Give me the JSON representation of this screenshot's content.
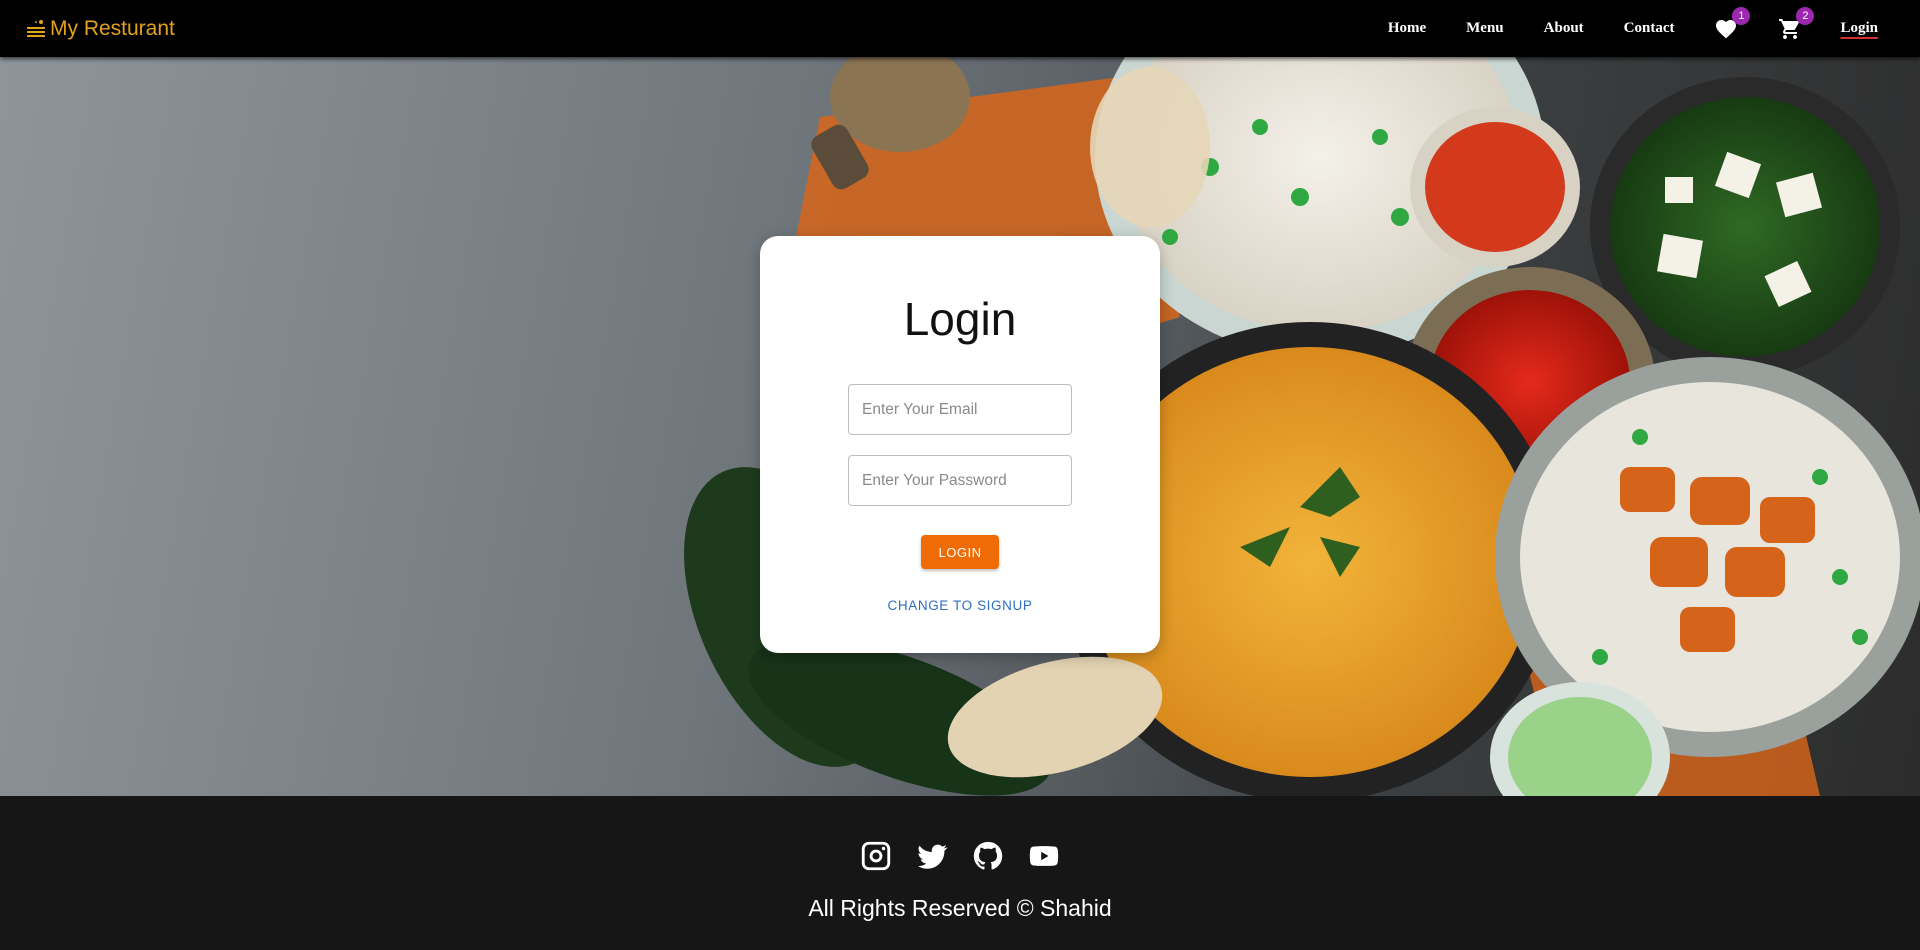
{
  "brand": {
    "name": "My Resturant",
    "icon": "restaurant-tray-icon",
    "color": "#e3a11c"
  },
  "nav": {
    "links": [
      "Home",
      "Menu",
      "About",
      "Contact"
    ],
    "wishlist": {
      "icon": "heart-icon",
      "count": "1"
    },
    "cart": {
      "icon": "cart-icon",
      "count": "2"
    },
    "login": "Login"
  },
  "login_card": {
    "title": "Login",
    "email_placeholder": "Enter Your Email",
    "password_placeholder": "Enter Your Password",
    "submit_label": "LOGIN",
    "switch_label": "CHANGE TO SIGNUP"
  },
  "footer": {
    "social": [
      "instagram-icon",
      "twitter-icon",
      "github-icon",
      "youtube-icon"
    ],
    "copyright": "All Rights Reserved © Shahid"
  },
  "colors": {
    "accent": "#ee6b06",
    "badge": "#9c27b0",
    "link": "#2f6fbf",
    "footer_bg": "#161616"
  }
}
